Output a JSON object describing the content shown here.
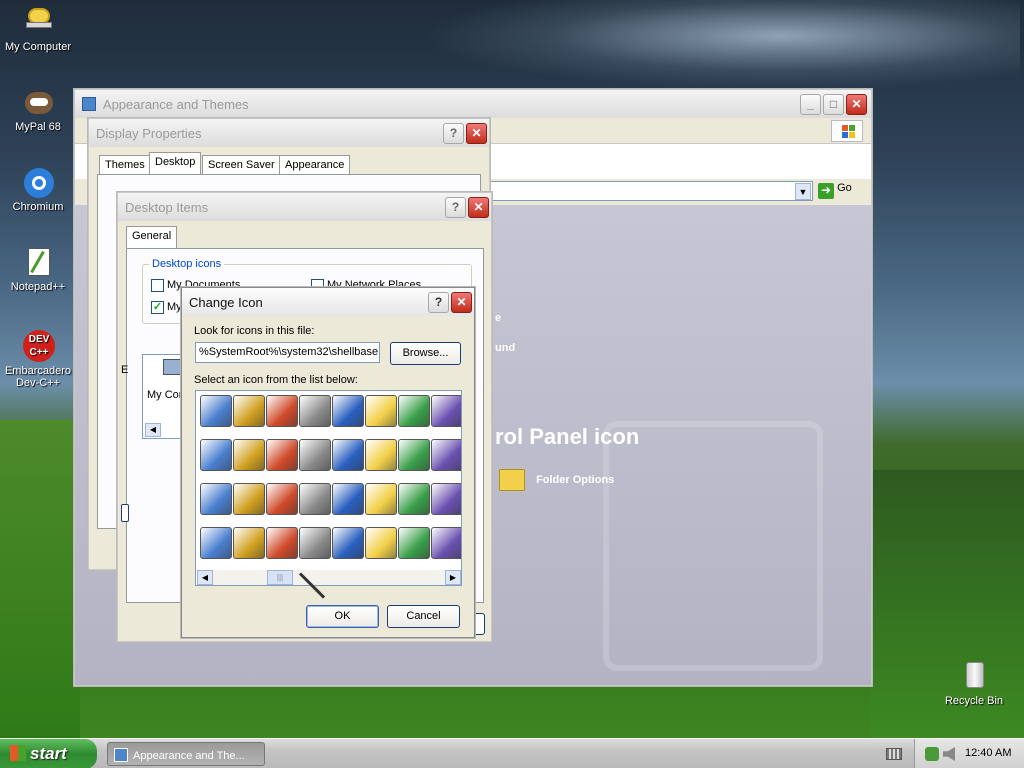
{
  "desktop": {
    "icons": [
      {
        "label": "My Computer",
        "icon": "my-computer-icon"
      },
      {
        "label": "MyPal 68",
        "icon": "mypal-icon"
      },
      {
        "label": "Chromium",
        "icon": "chromium-icon"
      },
      {
        "label": "Notepad++",
        "icon": "notepad-plus-plus-icon"
      },
      {
        "label": "Embarcadero Dev-C++",
        "icon": "devcpp-icon"
      },
      {
        "label": "Recycle Bin",
        "icon": "recycle-bin-icon"
      }
    ],
    "devcpp_badge": "DEV C++"
  },
  "control_panel": {
    "title": "Appearance and Themes",
    "go_label": "Go",
    "link_fragment_1": "e",
    "link_fragment_2": "und",
    "heading_fragment": "rol Panel icon",
    "folder_options": "Folder Options"
  },
  "display_properties": {
    "title": "Display Properties",
    "tabs": [
      "Themes",
      "Desktop",
      "Screen Saver",
      "Appearance"
    ],
    "active_tab": "Desktop"
  },
  "desktop_items": {
    "title": "Desktop Items",
    "tab": "General",
    "group_label": "Desktop icons",
    "checkboxes": [
      {
        "label": "My Documents",
        "checked": false
      },
      {
        "label": "My Network Places",
        "checked": false
      },
      {
        "label": "My",
        "checked": true
      }
    ],
    "list_item": "My Com",
    "side_letter": "E"
  },
  "change_icon": {
    "title": "Change Icon",
    "look_label": "Look for icons in this file:",
    "file_value": "%SystemRoot%\\system32\\shellbase.dll",
    "browse_label": "Browse...",
    "select_label": "Select an icon from the list below:",
    "ok_label": "OK",
    "cancel_label": "Cancel",
    "icons": [
      "globe-icon",
      "printer-icon",
      "recycle-bin-full-icon",
      "network-settings-icon",
      "package-icon",
      "window-icon",
      "blocks-icon",
      "page-icon",
      "checkmark-icon",
      "printer-icon",
      "transfer-icon",
      "tools-icon",
      "font-a-icon",
      "folder-error-icon",
      "printer-ok-icon",
      "folder-icon",
      "folder-printer-icon",
      "recycle-icon",
      "folder-up-icon",
      "document-icon",
      "font-t-icon",
      "computer-icon",
      "printer-ok-icon",
      "star-icon",
      "picture-icon",
      "recycle-full-icon",
      "folder-yellow-icon",
      "window-gear-icon",
      "font-a-red-icon",
      "cd-icon",
      "printer-ok-icon",
      "device-icon"
    ]
  },
  "taskbar": {
    "start_label": "start",
    "task_label": "Appearance and The...",
    "clock": "12:40 AM"
  }
}
